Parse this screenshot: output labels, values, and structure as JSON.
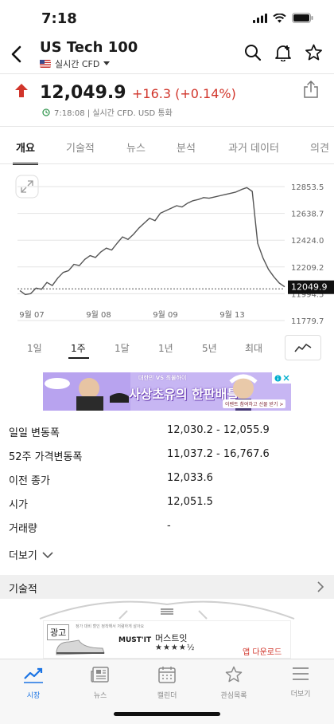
{
  "status": {
    "time": "7:18"
  },
  "header": {
    "title": "US Tech 100",
    "subtitle": "실시간 CFD"
  },
  "quote": {
    "price": "12,049.9",
    "change": "+16.3 (+0.14%)",
    "meta": "7:18:08 | 실시간 CFD. USD 통화"
  },
  "tabs": [
    "개요",
    "기술적",
    "뉴스",
    "분석",
    "과거 데이터",
    "의견"
  ],
  "chart_data": {
    "type": "line",
    "x_tick_labels": [
      "9월 07",
      "9월 08",
      "9월 09",
      "9월 13"
    ],
    "y_tick_labels": [
      "12853.5",
      "12638.7",
      "12424.0",
      "12209.2",
      "11994.5",
      "11779.7"
    ],
    "ylim": [
      11779.7,
      12853.5
    ],
    "current_value_label": "12049.9",
    "previous_close": 12033.6,
    "series": [
      {
        "values": [
          12020,
          11988,
          11995,
          12040,
          12030,
          12085,
          12060,
          12120,
          12165,
          12180,
          12230,
          12220,
          12270,
          12300,
          12285,
          12330,
          12360,
          12345,
          12400,
          12450,
          12430,
          12470,
          12520,
          12560,
          12600,
          12580,
          12640,
          12660,
          12680,
          12700,
          12690,
          12720,
          12740,
          12750,
          12765,
          12760,
          12770,
          12780,
          12790,
          12800,
          12810,
          12830,
          12845,
          12815,
          12400,
          12280,
          12190,
          12130,
          12080,
          12049.9
        ]
      }
    ]
  },
  "ranges": [
    "1일",
    "1주",
    "1달",
    "1년",
    "5년",
    "최대"
  ],
  "ad_banner": {
    "headline": "사상초유의 한판배틀",
    "top_text": "대한민 VS 최물하이",
    "cta": "이벤트 참여하고 선물 받기 >"
  },
  "stats": [
    {
      "label": "일일 변동폭",
      "value": "12,030.2 - 12,055.9"
    },
    {
      "label": "52주 가격변동폭",
      "value": "11,037.2 - 16,767.6"
    },
    {
      "label": "이전 종가",
      "value": "12,033.6"
    },
    {
      "label": "시가",
      "value": "12,051.5"
    },
    {
      "label": "거래량",
      "value": "-"
    }
  ],
  "more_label": "더보기",
  "section_label": "기술적",
  "ad2": {
    "tag": "광고",
    "brand": "MUST'IT",
    "name": "머스트잇",
    "rating": "★★★★½",
    "cta": "앱 다운로드",
    "fineprint": "정가 대비 할인 정착해서 저렴하게 살아요"
  },
  "nav": [
    {
      "label": "시장",
      "icon": "chart-trend-icon"
    },
    {
      "label": "뉴스",
      "icon": "newspaper-icon"
    },
    {
      "label": "캘린더",
      "icon": "calendar-icon"
    },
    {
      "label": "관심목록",
      "icon": "star-icon"
    },
    {
      "label": "더보기",
      "icon": "menu-icon"
    }
  ],
  "colors": {
    "up": "#d1352b",
    "accent": "#1b74e4",
    "line": "#555555"
  }
}
